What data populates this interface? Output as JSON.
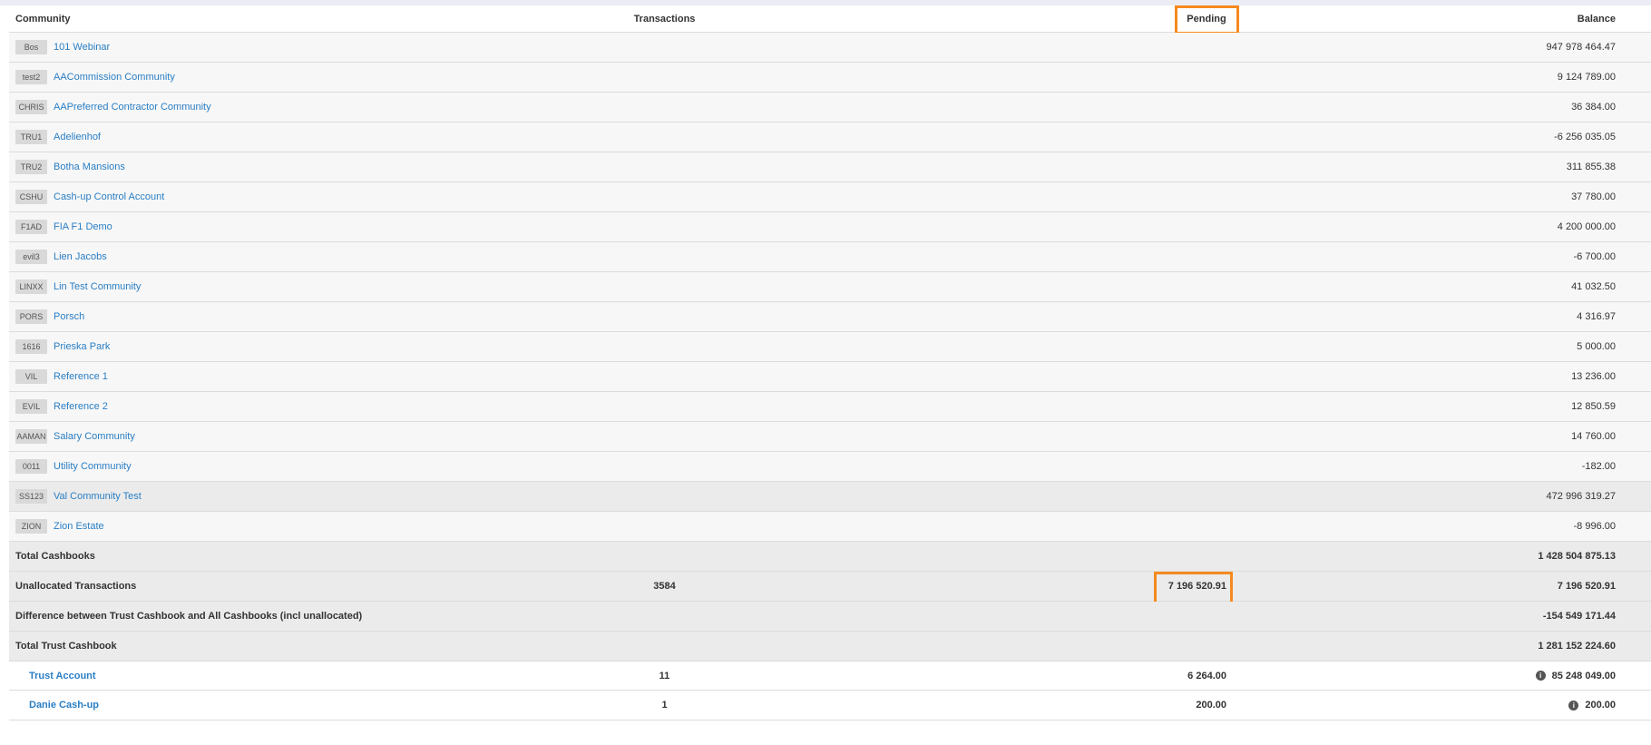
{
  "table": {
    "headers": {
      "community": "Community",
      "transactions": "Transactions",
      "pending": "Pending",
      "balance": "Balance"
    },
    "rows": [
      {
        "code": "Bos",
        "name": "101 Webinar",
        "balance": "947 978 464.47"
      },
      {
        "code": "test2",
        "name": "AACommission Community",
        "balance": "9 124 789.00"
      },
      {
        "code": "CHRIS",
        "name": "AAPreferred Contractor Community",
        "balance": "36 384.00"
      },
      {
        "code": "TRU1",
        "name": "Adelienhof",
        "balance": "-6 256 035.05"
      },
      {
        "code": "TRU2",
        "name": "Botha Mansions",
        "balance": "311 855.38"
      },
      {
        "code": "CSHU",
        "name": "Cash-up Control Account",
        "balance": "37 780.00"
      },
      {
        "code": "F1AD",
        "name": "FIA F1 Demo",
        "balance": "4 200 000.00"
      },
      {
        "code": "evil3",
        "name": "Lien Jacobs",
        "balance": "-6 700.00"
      },
      {
        "code": "LINXX",
        "name": "Lin Test Community",
        "balance": "41 032.50"
      },
      {
        "code": "PORS",
        "name": "Porsch",
        "balance": "4 316.97"
      },
      {
        "code": "1616",
        "name": "Prieska Park",
        "balance": "5 000.00"
      },
      {
        "code": "VIL",
        "name": "Reference 1",
        "balance": "13 236.00"
      },
      {
        "code": "EVIL",
        "name": "Reference 2",
        "balance": "12 850.59"
      },
      {
        "code": "AAMAN",
        "name": "Salary Community",
        "balance": "14 760.00"
      },
      {
        "code": "0011",
        "name": "Utility Community",
        "balance": "-182.00"
      },
      {
        "code": "SS123",
        "name": "Val Community Test",
        "balance": "472 996 319.27"
      },
      {
        "code": "ZION",
        "name": "Zion Estate",
        "balance": "-8 996.00"
      }
    ],
    "total_cashbooks": {
      "label": "Total Cashbooks",
      "balance": "1 428 504 875.13"
    },
    "unallocated": {
      "label": "Unallocated Transactions",
      "transactions": "3584",
      "pending": "7 196 520.91",
      "balance": "7 196 520.91"
    },
    "difference": {
      "label": "Difference between Trust Cashbook and All Cashbooks (incl unallocated)",
      "balance": "-154 549 171.44"
    },
    "total_trust": {
      "label": "Total Trust Cashbook",
      "balance": "1 281 152 224.60"
    },
    "accounts": [
      {
        "name": "Trust Account",
        "transactions": "11",
        "pending": "6 264.00",
        "balance": "85 248 049.00"
      },
      {
        "name": "Danie Cash-up",
        "transactions": "1",
        "pending": "200.00",
        "balance": "200.00"
      }
    ]
  },
  "colors": {
    "link": "#2a7ec4",
    "highlight": "#f58a1f",
    "badge_bg": "#d9d9d9"
  },
  "icons": {
    "info": "info-icon"
  }
}
